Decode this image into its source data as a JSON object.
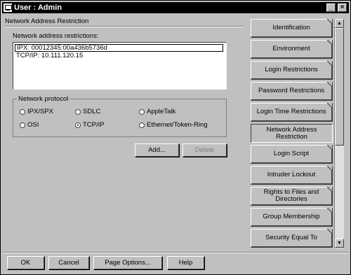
{
  "window": {
    "title": "User : Admin",
    "minimize_glyph": "_",
    "close_glyph": "×"
  },
  "page": {
    "heading": "Network Address Restriction",
    "list_label": "Network address restrictions:",
    "restrictions": [
      "IPX: 00012345:00a436b5736d",
      "TCP/IP: 10.111.120.15"
    ],
    "protocol_group_label": "Network protocol",
    "protocols": [
      {
        "label": "IPX/SPX",
        "selected": false
      },
      {
        "label": "SDLC",
        "selected": false
      },
      {
        "label": "AppleTalk",
        "selected": false
      },
      {
        "label": "OSI",
        "selected": false
      },
      {
        "label": "TCP/IP",
        "selected": true
      },
      {
        "label": "Ethernet/Token-Ring",
        "selected": false
      }
    ],
    "add_label": "Add...",
    "delete_label": "Delete"
  },
  "tabs": [
    {
      "label": "Identification",
      "active": false
    },
    {
      "label": "Environment",
      "active": false
    },
    {
      "label": "Login Restrictions",
      "active": false
    },
    {
      "label": "Password Restrictions",
      "active": false
    },
    {
      "label": "Login Time Restrictions",
      "active": false
    },
    {
      "label": "Network Address Restriction",
      "active": true
    },
    {
      "label": "Login Script",
      "active": false
    },
    {
      "label": "Intruder Lockout",
      "active": false
    },
    {
      "label": "Rights to Files and Directories",
      "active": false
    },
    {
      "label": "Group Membership",
      "active": false
    },
    {
      "label": "Security Equal To",
      "active": false
    }
  ],
  "footer": {
    "ok": "OK",
    "cancel": "Cancel",
    "page_options": "Page Options...",
    "help": "Help"
  }
}
